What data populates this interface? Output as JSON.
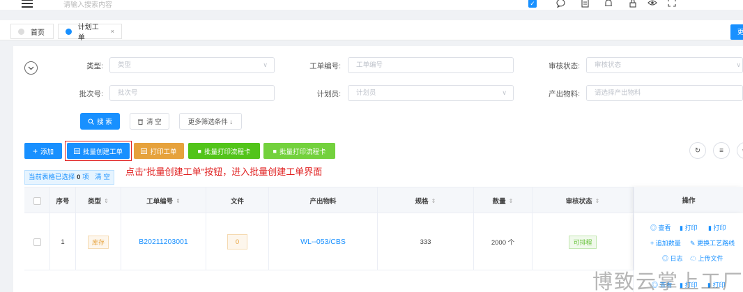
{
  "topbar": {
    "search_placeholder": "请输入搜索内容",
    "icons": [
      "menu-icon",
      "checkbox-icon",
      "message-icon",
      "document-icon",
      "bell-icon",
      "lock-icon",
      "eye-icon",
      "fullscreen-icon"
    ]
  },
  "tabs": [
    {
      "label": "首页",
      "active": false
    },
    {
      "label": "计划工单",
      "active": true,
      "close": "×"
    }
  ],
  "filters": {
    "type_label": "类型:",
    "type_placeholder": "类型",
    "order_no_label": "工单编号:",
    "order_no_placeholder": "工单编号",
    "audit_label": "审核状态:",
    "audit_placeholder": "审核状态",
    "batch_label": "批次号:",
    "batch_placeholder": "批次号",
    "planner_label": "计划员:",
    "planner_placeholder": "计划员",
    "material_label": "产出物料:",
    "material_placeholder": "请选择产出物料",
    "search_button": "搜 索",
    "clear_button": "清 空",
    "more_button": "更多筛选条件 ↓"
  },
  "actions": {
    "add": "添加",
    "batch_create": "批量创建工单",
    "print": "打印工单",
    "batch_print_card_1": "批量打印流程卡",
    "batch_print_card_2": "批量打印流程卡"
  },
  "colors": {
    "primary": "#1890ff",
    "orange": "#e6a23c",
    "green": "#52c41a",
    "light_green": "#73d13d",
    "highlight_red": "#e02020"
  },
  "selection": {
    "prefix": "当前表格已选择",
    "count": "0",
    "unit": "项",
    "clear": "清 空"
  },
  "annotation": "点击\"批量创建工单\"按钮，进入批量创建工单界面",
  "table": {
    "headers": {
      "index": "序号",
      "type": "类型",
      "order_no": "工单编号",
      "file": "文件",
      "material": "产出物料",
      "spec": "规格",
      "qty": "数量",
      "audit": "审核状态",
      "ops": "操作"
    },
    "rows": [
      {
        "index": "1",
        "type": "库存",
        "order_no": "B20211203001",
        "file": "0",
        "material": "WL--053/CBS",
        "spec": "333",
        "qty": "2000 个",
        "audit": "可排程",
        "ops": {
          "view": "查看",
          "print1": "打印",
          "print2": "打印",
          "add_qty": "追加数量",
          "change_route": "更换工艺路线",
          "log": "日志",
          "upload": "上传文件"
        }
      }
    ],
    "row2_ops": {
      "view": "查看",
      "print1": "打印",
      "print2": "打印"
    }
  },
  "watermark": "博致云掌上工厂"
}
